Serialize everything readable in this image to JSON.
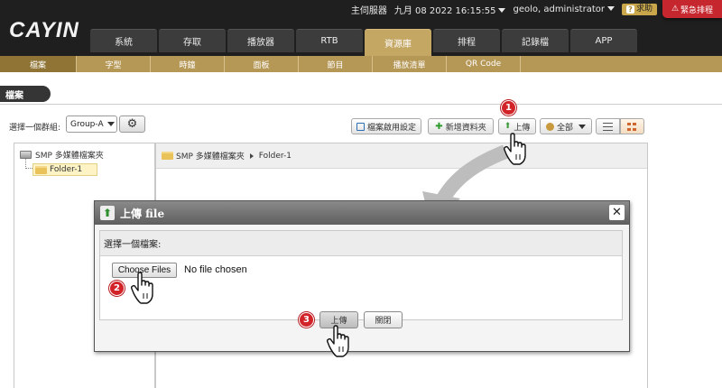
{
  "topbar": {
    "logo": "CAYIN",
    "server": "主伺服器",
    "datetime": "九月 08 2022 16:15:55",
    "user": "geolo, administrator",
    "help": "求助",
    "emergency": "緊急排程"
  },
  "main_tabs": [
    "系統",
    "存取",
    "播放器",
    "RTB",
    "資源庫",
    "排程",
    "記錄檔",
    "APP"
  ],
  "sub_tabs": [
    "檔案",
    "字型",
    "時鐘",
    "面板",
    "節目",
    "播放清單",
    "QR Code"
  ],
  "page": {
    "title": "檔案",
    "group_label": "選擇一個群組:",
    "group_value": "Group-A"
  },
  "toolbar": {
    "enable_settings": "檔案啟用設定",
    "new_folder": "新增資料夾",
    "upload": "上傳",
    "filter_all": "全部"
  },
  "tree": {
    "root": "SMP 多媒體檔案夾",
    "child": "Folder-1"
  },
  "breadcrumb": {
    "root": "SMP 多媒體檔案夾",
    "current": "Folder-1"
  },
  "modal": {
    "title": "上傳 file",
    "label": "選擇一個檔案:",
    "choose_button": "Choose Files",
    "no_file": "No file chosen",
    "upload_button": "上傳",
    "close_button": "關閉"
  },
  "steps": [
    "1",
    "2",
    "3"
  ],
  "colors": {
    "accent_gold": "#c5a764",
    "step_badge": "#d22328",
    "topbar": "#1f1f1f"
  },
  "icons": [
    "gear-icon",
    "upload-icon",
    "folder-icon",
    "close-icon",
    "hand-cursor-icon",
    "list-view-icon",
    "grid-view-icon"
  ]
}
